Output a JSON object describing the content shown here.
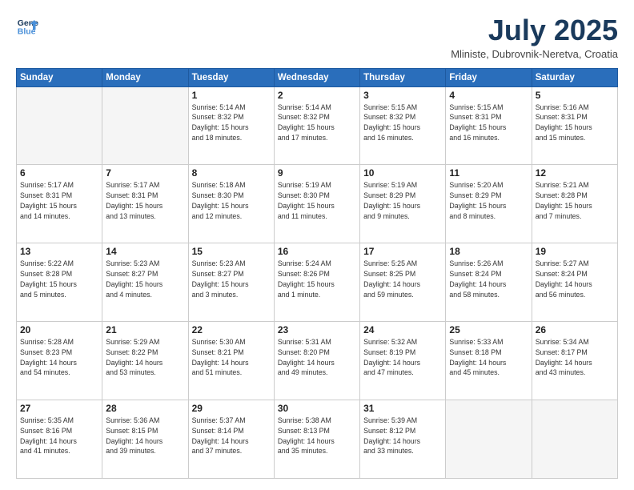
{
  "header": {
    "logo_line1": "General",
    "logo_line2": "Blue",
    "title": "July 2025",
    "location": "Mliniste, Dubrovnik-Neretva, Croatia"
  },
  "days_of_week": [
    "Sunday",
    "Monday",
    "Tuesday",
    "Wednesday",
    "Thursday",
    "Friday",
    "Saturday"
  ],
  "weeks": [
    [
      {
        "day": "",
        "detail": ""
      },
      {
        "day": "",
        "detail": ""
      },
      {
        "day": "1",
        "detail": "Sunrise: 5:14 AM\nSunset: 8:32 PM\nDaylight: 15 hours\nand 18 minutes."
      },
      {
        "day": "2",
        "detail": "Sunrise: 5:14 AM\nSunset: 8:32 PM\nDaylight: 15 hours\nand 17 minutes."
      },
      {
        "day": "3",
        "detail": "Sunrise: 5:15 AM\nSunset: 8:32 PM\nDaylight: 15 hours\nand 16 minutes."
      },
      {
        "day": "4",
        "detail": "Sunrise: 5:15 AM\nSunset: 8:31 PM\nDaylight: 15 hours\nand 16 minutes."
      },
      {
        "day": "5",
        "detail": "Sunrise: 5:16 AM\nSunset: 8:31 PM\nDaylight: 15 hours\nand 15 minutes."
      }
    ],
    [
      {
        "day": "6",
        "detail": "Sunrise: 5:17 AM\nSunset: 8:31 PM\nDaylight: 15 hours\nand 14 minutes."
      },
      {
        "day": "7",
        "detail": "Sunrise: 5:17 AM\nSunset: 8:31 PM\nDaylight: 15 hours\nand 13 minutes."
      },
      {
        "day": "8",
        "detail": "Sunrise: 5:18 AM\nSunset: 8:30 PM\nDaylight: 15 hours\nand 12 minutes."
      },
      {
        "day": "9",
        "detail": "Sunrise: 5:19 AM\nSunset: 8:30 PM\nDaylight: 15 hours\nand 11 minutes."
      },
      {
        "day": "10",
        "detail": "Sunrise: 5:19 AM\nSunset: 8:29 PM\nDaylight: 15 hours\nand 9 minutes."
      },
      {
        "day": "11",
        "detail": "Sunrise: 5:20 AM\nSunset: 8:29 PM\nDaylight: 15 hours\nand 8 minutes."
      },
      {
        "day": "12",
        "detail": "Sunrise: 5:21 AM\nSunset: 8:28 PM\nDaylight: 15 hours\nand 7 minutes."
      }
    ],
    [
      {
        "day": "13",
        "detail": "Sunrise: 5:22 AM\nSunset: 8:28 PM\nDaylight: 15 hours\nand 5 minutes."
      },
      {
        "day": "14",
        "detail": "Sunrise: 5:23 AM\nSunset: 8:27 PM\nDaylight: 15 hours\nand 4 minutes."
      },
      {
        "day": "15",
        "detail": "Sunrise: 5:23 AM\nSunset: 8:27 PM\nDaylight: 15 hours\nand 3 minutes."
      },
      {
        "day": "16",
        "detail": "Sunrise: 5:24 AM\nSunset: 8:26 PM\nDaylight: 15 hours\nand 1 minute."
      },
      {
        "day": "17",
        "detail": "Sunrise: 5:25 AM\nSunset: 8:25 PM\nDaylight: 14 hours\nand 59 minutes."
      },
      {
        "day": "18",
        "detail": "Sunrise: 5:26 AM\nSunset: 8:24 PM\nDaylight: 14 hours\nand 58 minutes."
      },
      {
        "day": "19",
        "detail": "Sunrise: 5:27 AM\nSunset: 8:24 PM\nDaylight: 14 hours\nand 56 minutes."
      }
    ],
    [
      {
        "day": "20",
        "detail": "Sunrise: 5:28 AM\nSunset: 8:23 PM\nDaylight: 14 hours\nand 54 minutes."
      },
      {
        "day": "21",
        "detail": "Sunrise: 5:29 AM\nSunset: 8:22 PM\nDaylight: 14 hours\nand 53 minutes."
      },
      {
        "day": "22",
        "detail": "Sunrise: 5:30 AM\nSunset: 8:21 PM\nDaylight: 14 hours\nand 51 minutes."
      },
      {
        "day": "23",
        "detail": "Sunrise: 5:31 AM\nSunset: 8:20 PM\nDaylight: 14 hours\nand 49 minutes."
      },
      {
        "day": "24",
        "detail": "Sunrise: 5:32 AM\nSunset: 8:19 PM\nDaylight: 14 hours\nand 47 minutes."
      },
      {
        "day": "25",
        "detail": "Sunrise: 5:33 AM\nSunset: 8:18 PM\nDaylight: 14 hours\nand 45 minutes."
      },
      {
        "day": "26",
        "detail": "Sunrise: 5:34 AM\nSunset: 8:17 PM\nDaylight: 14 hours\nand 43 minutes."
      }
    ],
    [
      {
        "day": "27",
        "detail": "Sunrise: 5:35 AM\nSunset: 8:16 PM\nDaylight: 14 hours\nand 41 minutes."
      },
      {
        "day": "28",
        "detail": "Sunrise: 5:36 AM\nSunset: 8:15 PM\nDaylight: 14 hours\nand 39 minutes."
      },
      {
        "day": "29",
        "detail": "Sunrise: 5:37 AM\nSunset: 8:14 PM\nDaylight: 14 hours\nand 37 minutes."
      },
      {
        "day": "30",
        "detail": "Sunrise: 5:38 AM\nSunset: 8:13 PM\nDaylight: 14 hours\nand 35 minutes."
      },
      {
        "day": "31",
        "detail": "Sunrise: 5:39 AM\nSunset: 8:12 PM\nDaylight: 14 hours\nand 33 minutes."
      },
      {
        "day": "",
        "detail": ""
      },
      {
        "day": "",
        "detail": ""
      }
    ]
  ]
}
